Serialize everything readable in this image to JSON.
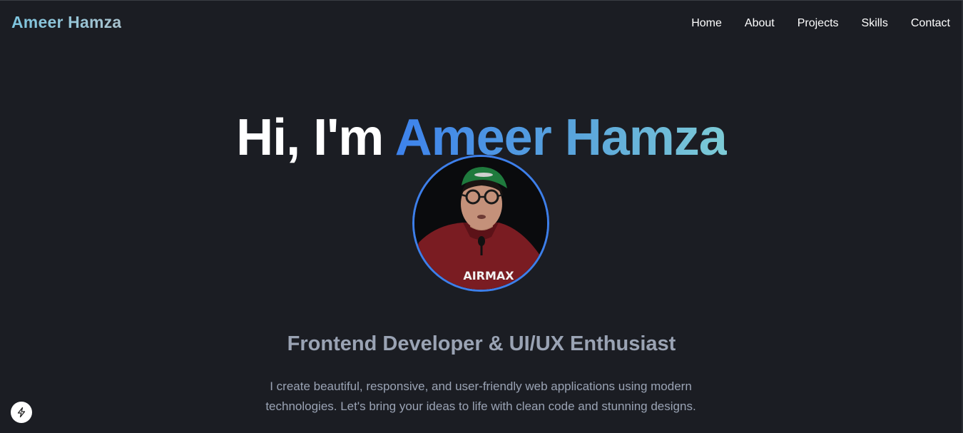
{
  "navbar": {
    "brand": "Ameer Hamza",
    "links": [
      {
        "label": "Home"
      },
      {
        "label": "About"
      },
      {
        "label": "Projects"
      },
      {
        "label": "Skills"
      },
      {
        "label": "Contact"
      }
    ]
  },
  "hero": {
    "greeting": "Hi, I'm ",
    "name": "Ameer Hamza",
    "subtitle": "Frontend Developer & UI/UX Enthusiast",
    "description": "I create beautiful, responsive, and user-friendly web applications using modern technologies. Let's bring your ideas to life with clean code and stunning designs.",
    "avatar_shirt_text": "AIRMAX"
  },
  "colors": {
    "background": "#1b1d23",
    "accent_blue": "#3d82ec",
    "accent_teal": "#7dcbd6",
    "muted_text": "#9aa3b4"
  },
  "icons": {
    "floating_button": "lightning-bolt-icon"
  }
}
